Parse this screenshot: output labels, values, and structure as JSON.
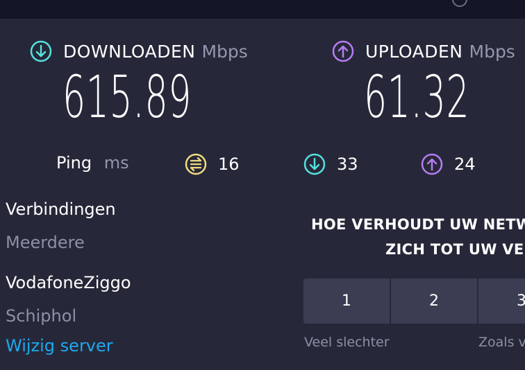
{
  "download": {
    "label": "DOWNLOADEN",
    "unit": "Mbps",
    "value": "615.89",
    "icon": "download-arrow-icon",
    "color": "#56e2de"
  },
  "upload": {
    "label": "UPLOADEN",
    "unit": "Mbps",
    "value": "61.32",
    "icon": "upload-arrow-icon",
    "color": "#b77cf2"
  },
  "ping": {
    "label": "Ping",
    "unit": "ms",
    "idle": {
      "value": "16",
      "icon": "ping-idle-icon",
      "color": "#f0db7e"
    },
    "download": {
      "value": "33",
      "icon": "ping-download-icon",
      "color": "#56e2de"
    },
    "upload": {
      "value": "24",
      "icon": "ping-upload-icon",
      "color": "#b77cf2"
    }
  },
  "connections": {
    "title": "Verbindingen",
    "value": "Meerdere"
  },
  "server": {
    "provider": "VodafoneZiggo",
    "location": "Schiphol",
    "change_link": "Wijzig server"
  },
  "survey": {
    "question_line1": "HOE VERHOUDT UW NETW",
    "question_line2": "ZICH TOT UW VE",
    "options": [
      "1",
      "2",
      "3"
    ],
    "label_low": "Veel slechter",
    "label_mid": "Zoals v"
  }
}
